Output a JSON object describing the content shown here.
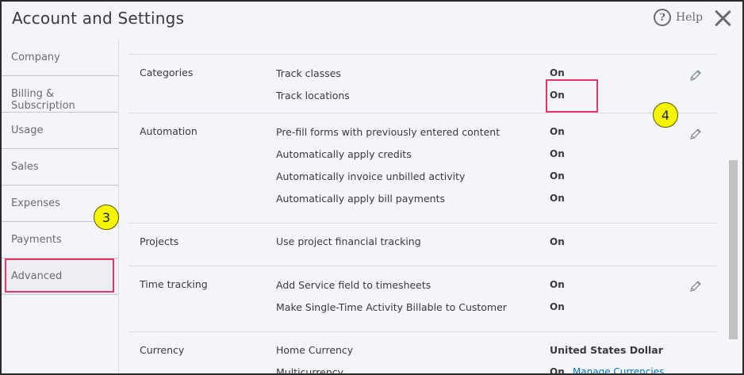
{
  "header": {
    "title": "Account and Settings",
    "help_label": "Help",
    "help_glyph": "?"
  },
  "sidebar": {
    "items": [
      {
        "label": "Company"
      },
      {
        "label": "Billing & Subscription"
      },
      {
        "label": "Usage"
      },
      {
        "label": "Sales"
      },
      {
        "label": "Expenses"
      },
      {
        "label": "Payments"
      },
      {
        "label": "Advanced",
        "active": true
      }
    ]
  },
  "annotations": {
    "badge_sidebar": "3",
    "badge_edit": "4",
    "highlight_color": "#e3356b",
    "badge_color": "#f5f500"
  },
  "sections": {
    "categories": {
      "title": "Categories",
      "settings": [
        {
          "label": "Track classes",
          "value": "On"
        },
        {
          "label": "Track locations",
          "value": "On"
        }
      ]
    },
    "automation": {
      "title": "Automation",
      "settings": [
        {
          "label": "Pre-fill forms with previously entered content",
          "value": "On"
        },
        {
          "label": "Automatically apply credits",
          "value": "On"
        },
        {
          "label": "Automatically invoice unbilled activity",
          "value": "On"
        },
        {
          "label": "Automatically apply bill payments",
          "value": "On"
        }
      ]
    },
    "projects": {
      "title": "Projects",
      "settings": [
        {
          "label": "Use project financial tracking",
          "value": "On"
        }
      ]
    },
    "time_tracking": {
      "title": "Time tracking",
      "settings": [
        {
          "label": "Add Service field to timesheets",
          "value": "On"
        },
        {
          "label": "Make Single-Time Activity Billable to Customer",
          "value": "On"
        }
      ]
    },
    "currency": {
      "title": "Currency",
      "settings": [
        {
          "label": "Home Currency",
          "value": "United States Dollar"
        },
        {
          "label": "Multicurrency",
          "value": "On",
          "link": "Manage Currencies"
        }
      ]
    }
  }
}
